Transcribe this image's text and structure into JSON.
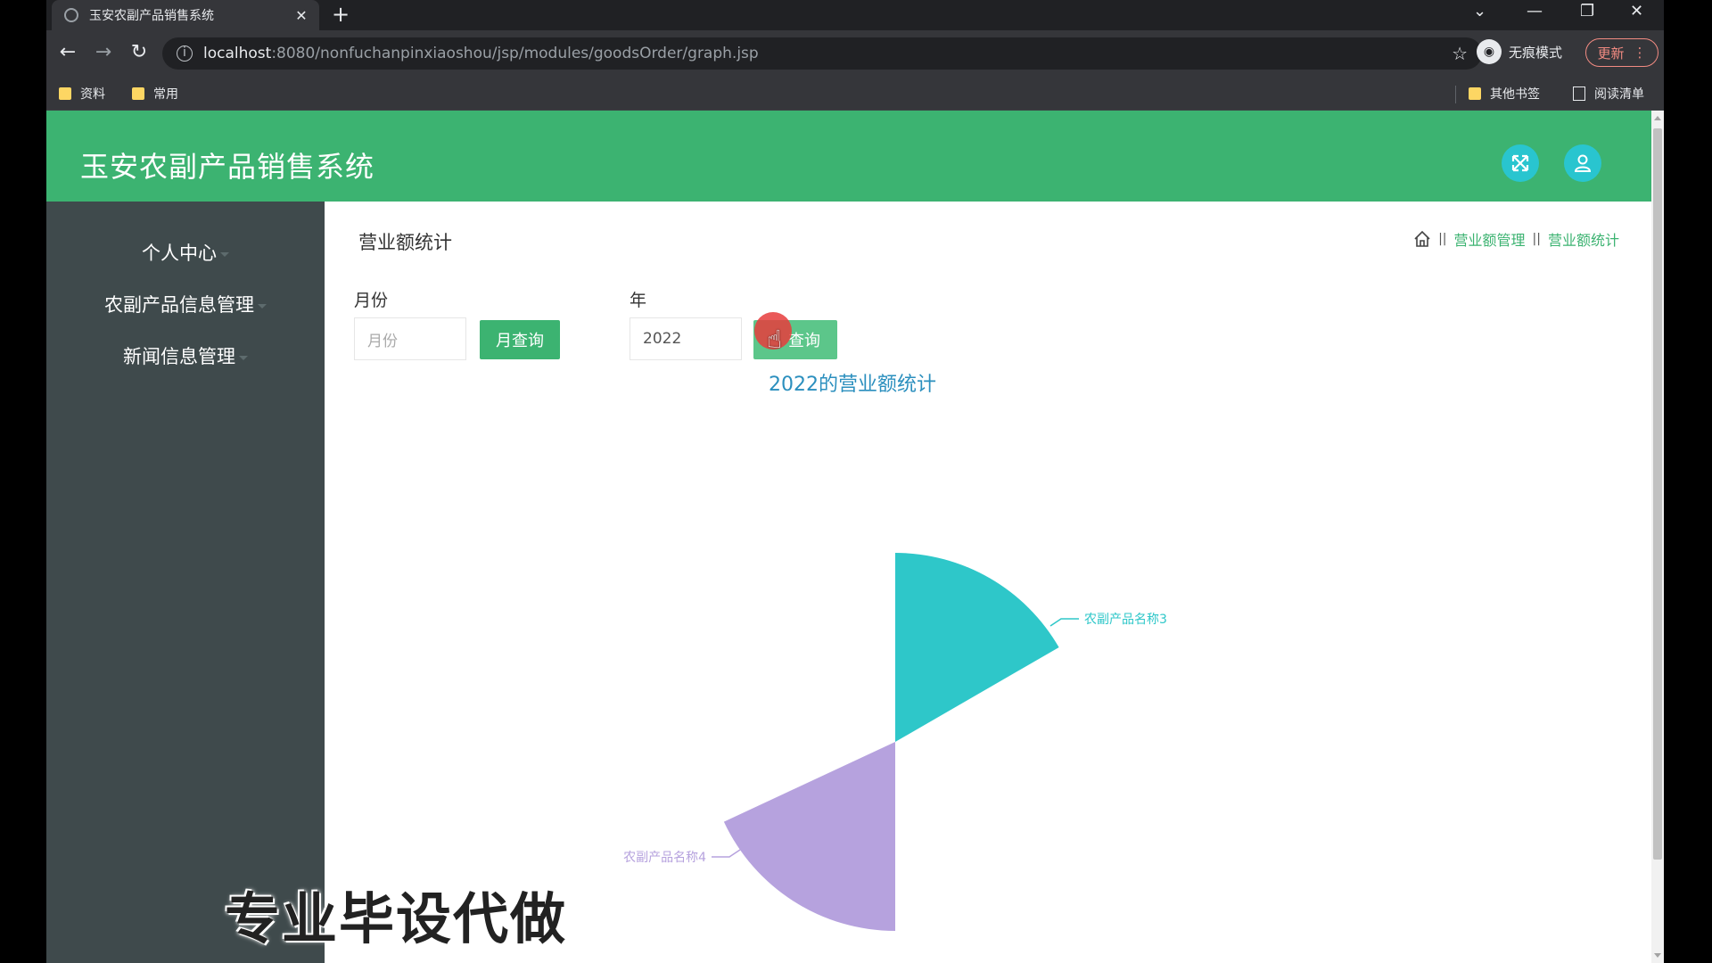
{
  "browser": {
    "tab_title": "玉安农副产品销售系统",
    "tab_close": "✕",
    "new_tab": "+",
    "url_host": "localhost",
    "url_rest": ":8080/nonfuchanpinxiaoshou/jsp/modules/goodsOrder/graph.jsp",
    "incognito_label": "无痕模式",
    "update_label": "更新",
    "bookmarks": [
      "资料",
      "常用"
    ],
    "other_bookmarks": "其他书签",
    "reading_list": "阅读清单"
  },
  "app": {
    "title": "玉安农副产品销售系统"
  },
  "sidebar": {
    "items": [
      {
        "label": "个人中心"
      },
      {
        "label": "农副产品信息管理"
      },
      {
        "label": "新闻信息管理"
      }
    ]
  },
  "main": {
    "title": "营业额统计",
    "breadcrumb": [
      "营业额管理",
      "营业额统计"
    ],
    "month_label": "月份",
    "month_placeholder": "月份",
    "month_button": "月查询",
    "year_label": "年",
    "year_value": "2022",
    "year_button": "年查询",
    "year_button_visible": "查询"
  },
  "chart_data": {
    "type": "pie",
    "title": "2022的营业额统计",
    "rose": true,
    "slices": [
      {
        "name": "农副产品名称3",
        "value": 1.0,
        "color": "#2ec7c9"
      },
      {
        "name": "农副产品名称4",
        "value": 1.0,
        "color": "#b6a2de"
      }
    ]
  },
  "overlay": {
    "watermark": "专业毕设代做"
  },
  "colors": {
    "primary": "#3cb371",
    "sidebar": "#3f4a4c",
    "header_button": "#29c5cf"
  }
}
